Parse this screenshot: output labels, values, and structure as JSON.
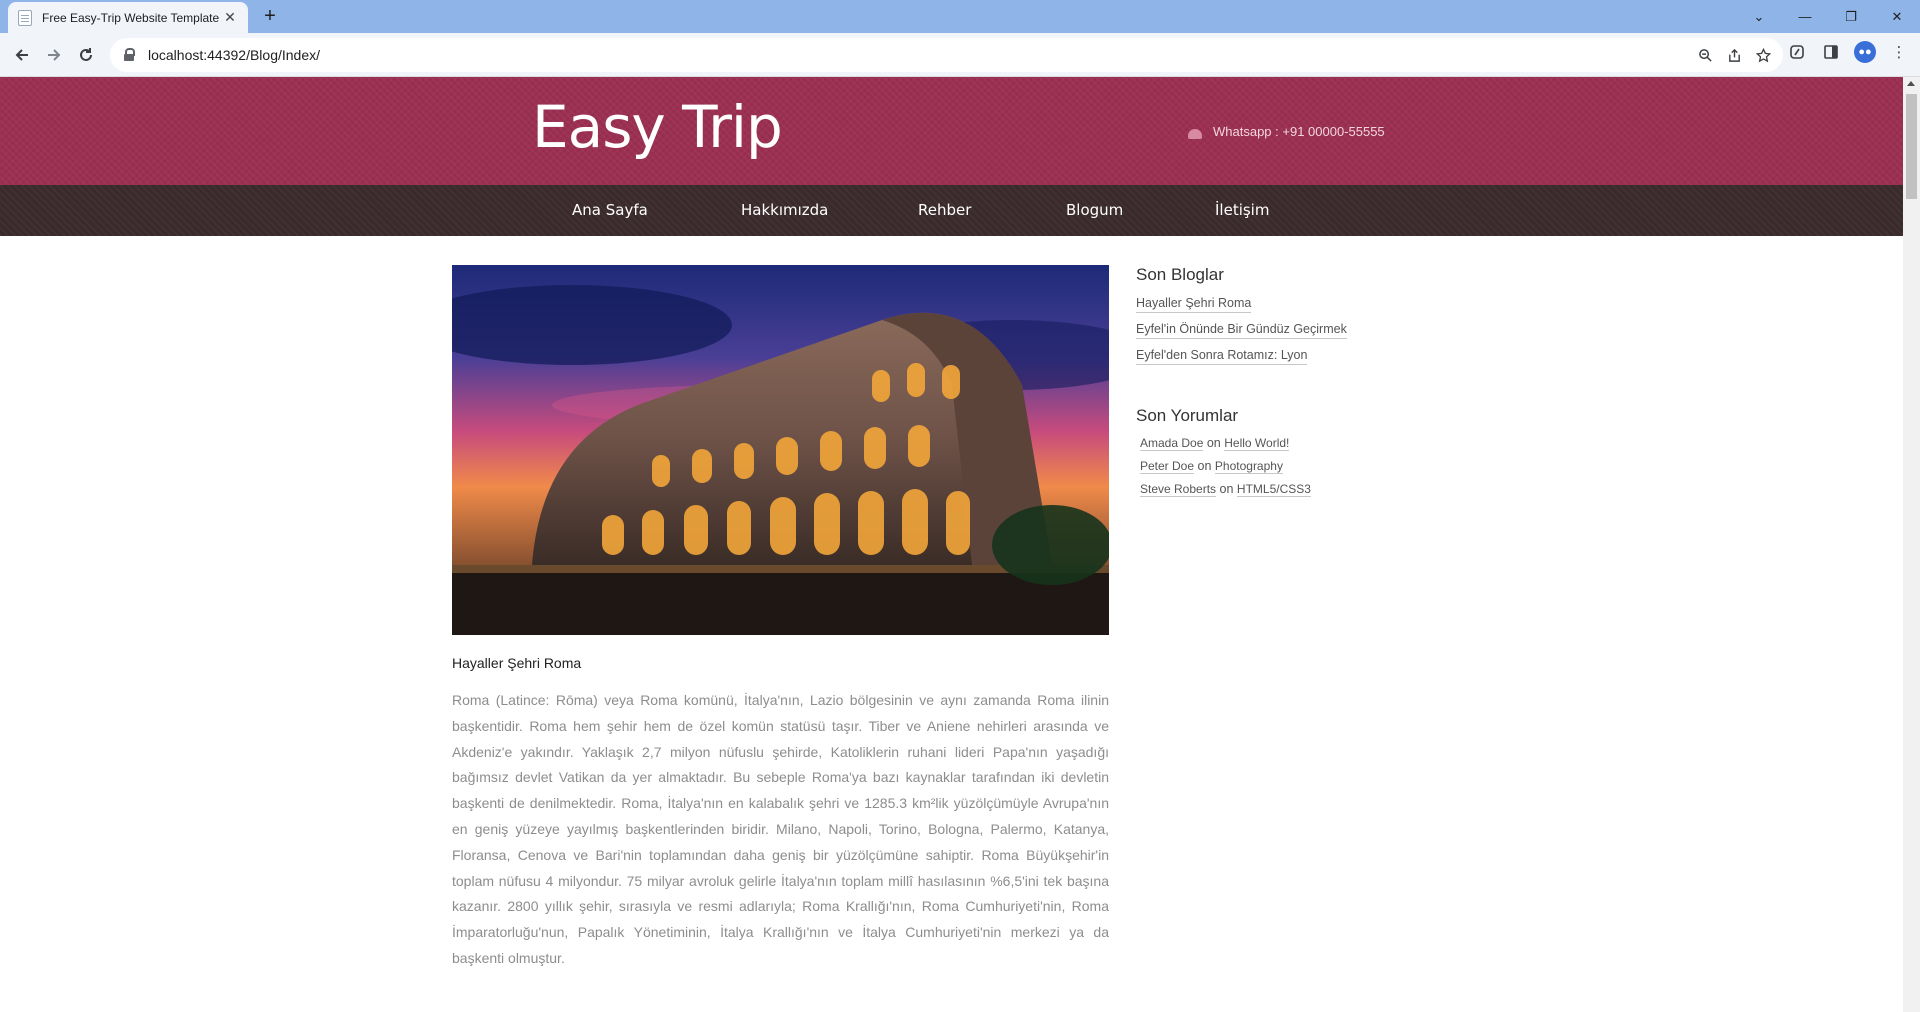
{
  "browser": {
    "tab_title": "Free Easy-Trip Website Template",
    "tab_close": "✕",
    "new_tab": "+",
    "url": "localhost:44392/Blog/Index/",
    "controls": {
      "dropdown": "⌄",
      "minimize": "—",
      "restore": "❐",
      "close": "✕"
    }
  },
  "header": {
    "logo": "Easy Trip",
    "contact": "Whatsapp : +91 00000-55555"
  },
  "nav": {
    "items": [
      {
        "label": "Ana Sayfa"
      },
      {
        "label": "Hakkımızda"
      },
      {
        "label": "Rehber"
      },
      {
        "label": "Blogum"
      },
      {
        "label": "İletişim"
      }
    ]
  },
  "post": {
    "title": "Hayaller Şehri Roma",
    "body": "Roma (Latince: Rōma) veya Roma komünü, İtalya'nın, Lazio bölgesinin ve aynı zamanda Roma ilinin başkentidir. Roma hem şehir hem de özel komün statüsü taşır. Tiber ve Aniene nehirleri arasında ve Akdeniz'e yakındır. Yaklaşık 2,7 milyon nüfuslu şehirde, Katoliklerin ruhani lideri Papa'nın yaşadığı bağımsız devlet Vatikan da yer almaktadır. Bu sebeple Roma'ya bazı kaynaklar tarafından iki devletin başkenti de denilmektedir. Roma, İtalya'nın en kalabalık şehri ve 1285.3 km²lik yüzölçümüyle Avrupa'nın en geniş yüzeye yayılmış başkentlerinden biridir. Milano, Napoli, Torino, Bologna, Palermo, Katanya, Floransa, Cenova ve Bari'nin toplamından daha geniş bir yüzölçümüne sahiptir. Roma Büyükşehir'in toplam nüfusu 4 milyondur. 75 milyar avroluk gelirle İtalya'nın toplam millî hasılasının %6,5'ini tek başına kazanır. 2800 yıllık şehir, sırasıyla ve resmi adlarıyla; Roma Krallığı'nın, Roma Cumhuriyeti'nin, Roma İmparatorluğu'nun, Papalık Yönetiminin, İtalya Krallığı'nın ve İtalya Cumhuriyeti'nin merkezi ya da başkenti olmuştur."
  },
  "sidebar": {
    "recent_title": "Son Bloglar",
    "recent": [
      {
        "label": "Hayaller Şehri Roma"
      },
      {
        "label": "Eyfel'in Önünde Bir Gündüz Geçirmek"
      },
      {
        "label": "Eyfel'den Sonra Rotamız: Lyon"
      }
    ],
    "comments_title": "Son Yorumlar",
    "comments": [
      {
        "author": "Amada Doe",
        "sep": "on",
        "post": "Hello World!"
      },
      {
        "author": "Peter Doe",
        "sep": "on",
        "post": "Photography"
      },
      {
        "author": "Steve Roberts",
        "sep": "on",
        "post": "HTML5/CSS3"
      }
    ]
  }
}
